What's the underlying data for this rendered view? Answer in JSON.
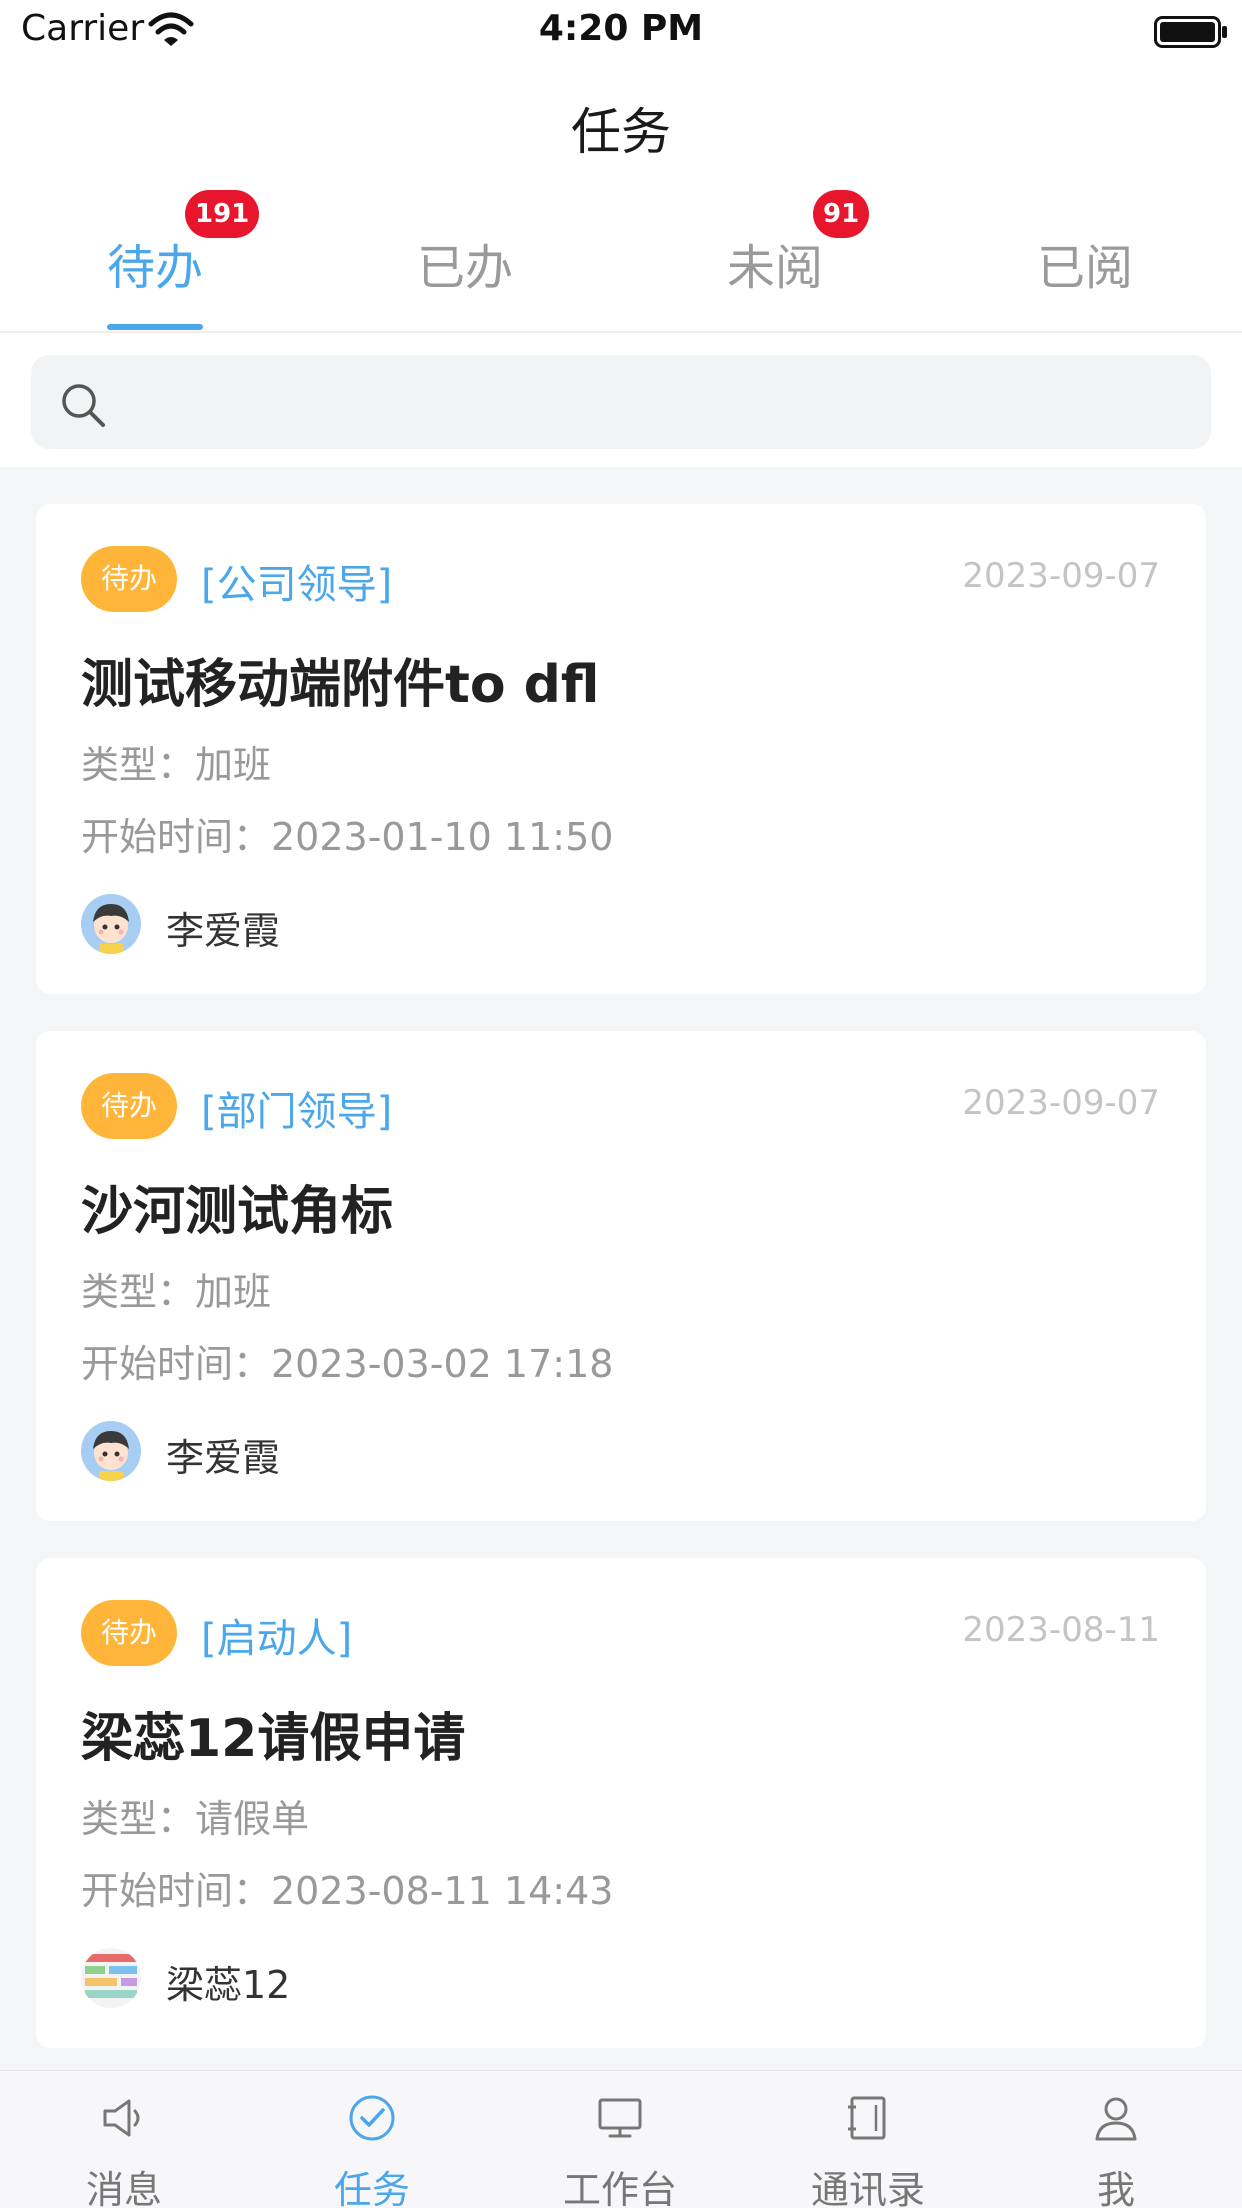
{
  "status_bar": {
    "carrier": "Carrier",
    "time": "4:20 PM"
  },
  "nav": {
    "title": "任务"
  },
  "tabs": [
    {
      "label": "待办",
      "badge": "191",
      "active": true
    },
    {
      "label": "已办",
      "badge": "",
      "active": false
    },
    {
      "label": "未阅",
      "badge": "91",
      "active": false
    },
    {
      "label": "已阅",
      "badge": "",
      "active": false
    }
  ],
  "search": {
    "placeholder": ""
  },
  "tasks": [
    {
      "tag": "待办",
      "category": "[公司领导]",
      "date": "2023-09-07",
      "title": "测试移动端附件to  dfl",
      "type": "类型：加班",
      "start_time": "开始时间：2023-01-10  11:50",
      "author": "李爱霞",
      "avatar": "boy-avatar-icon"
    },
    {
      "tag": "待办",
      "category": "[部门领导]",
      "date": "2023-09-07",
      "title": "沙河测试角标",
      "type": "类型：加班",
      "start_time": "开始时间：2023-03-02  17:18",
      "author": "李爱霞",
      "avatar": "boy-avatar-icon"
    },
    {
      "tag": "待办",
      "category": "[启动人]",
      "date": "2023-08-11",
      "title": "梁蕊12请假申请",
      "type": "类型：请假单",
      "start_time": "开始时间：2023-08-11  14:43",
      "author": "梁蕊12",
      "avatar": "colorful-avatar-icon"
    }
  ],
  "tab_bar": [
    {
      "label": "消息",
      "icon": "speaker-icon",
      "active": false
    },
    {
      "label": "任务",
      "icon": "check-circle-icon",
      "active": true
    },
    {
      "label": "工作台",
      "icon": "monitor-icon",
      "active": false
    },
    {
      "label": "通讯录",
      "icon": "contacts-book-icon",
      "active": false
    },
    {
      "label": "我",
      "icon": "person-icon",
      "active": false
    }
  ],
  "colors": {
    "accent": "#4ba6ea",
    "badge": "#e8162c",
    "tag": "#ffb53a"
  }
}
